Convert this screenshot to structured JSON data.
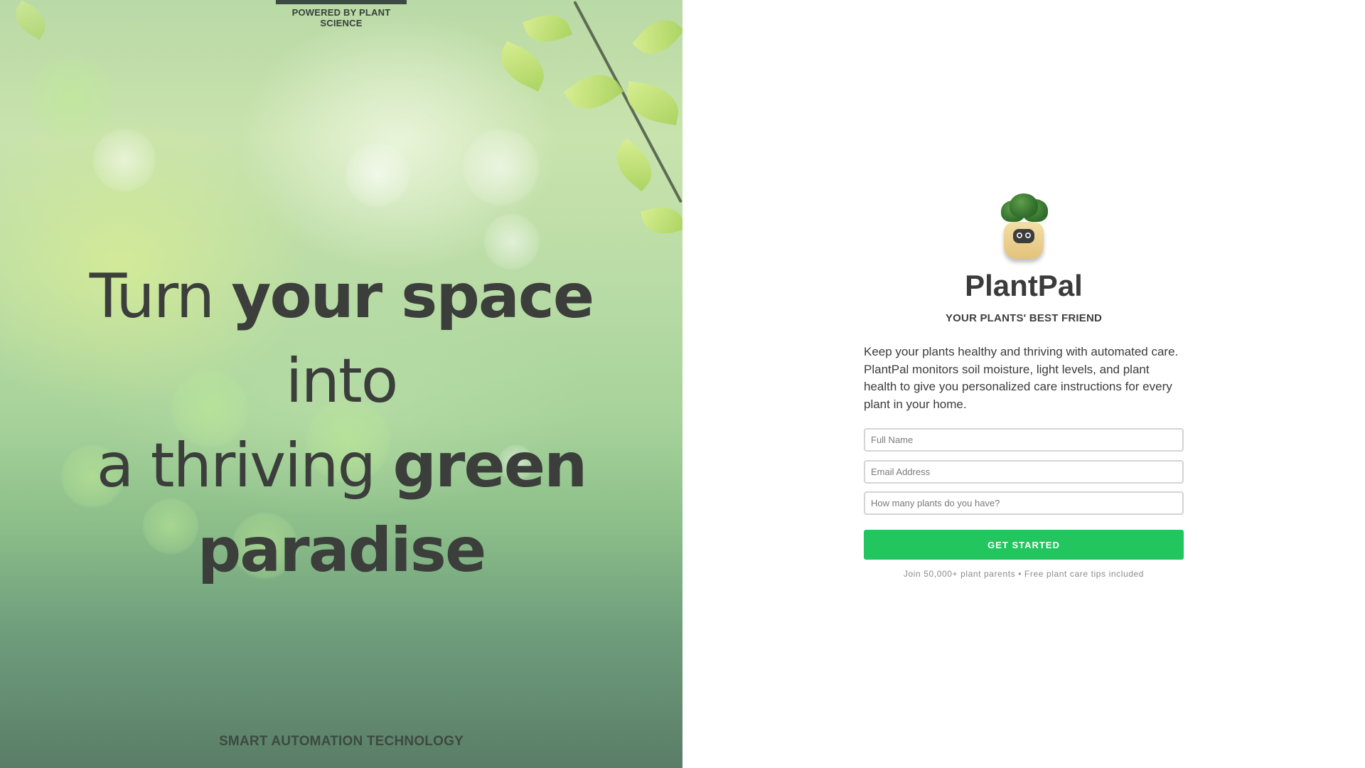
{
  "hero": {
    "powered_by": "POWERED BY PLANT SCIENCE",
    "headline": {
      "line1_a": "Turn ",
      "line1_b": "your space",
      "line1_c": " into",
      "line2_a": "a thriving ",
      "line2_b": "green",
      "line3": "paradise"
    },
    "tagline": "SMART AUTOMATION TECHNOLOGY"
  },
  "signup": {
    "logo_icon": "plant-robot-pot-icon",
    "brand": "PlantPal",
    "subtitle": "YOUR PLANTS' BEST FRIEND",
    "description": "Keep your plants healthy and thriving with automated care. PlantPal monitors soil moisture, light levels, and plant health to give you personalized care instructions for every plant in your home.",
    "fields": {
      "name_placeholder": "Full Name",
      "email_placeholder": "Email Address",
      "plants_placeholder": "How many plants do you have?"
    },
    "cta_label": "GET STARTED",
    "footnote": "Join 50,000+ plant parents • Free plant care tips included"
  },
  "colors": {
    "accent": "#22c55e",
    "text": "#3b3b3b",
    "topbar": "#3b4a42"
  }
}
